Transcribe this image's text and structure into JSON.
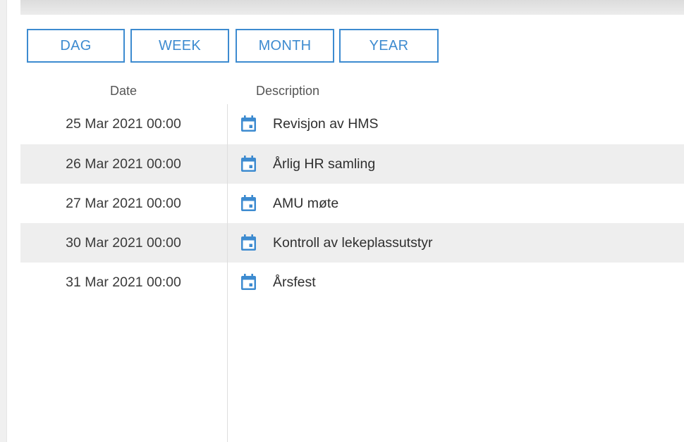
{
  "view_buttons": {
    "day": "DAG",
    "week": "WEEK",
    "month": "MONTH",
    "year": "YEAR"
  },
  "columns": {
    "date": "Date",
    "description": "Description"
  },
  "events": [
    {
      "date": "25 Mar 2021 00:00",
      "description": "Revisjon av HMS",
      "icon": "calendar-icon"
    },
    {
      "date": "26 Mar 2021 00:00",
      "description": "Årlig HR samling",
      "icon": "calendar-icon"
    },
    {
      "date": "27 Mar 2021 00:00",
      "description": "AMU møte",
      "icon": "calendar-icon"
    },
    {
      "date": "30 Mar 2021 00:00",
      "description": "Kontroll av lekeplassutstyr",
      "icon": "calendar-icon"
    },
    {
      "date": "31 Mar 2021 00:00",
      "description": "Årsfest",
      "icon": "calendar-icon"
    }
  ],
  "colors": {
    "accent": "#3d8bd0",
    "row_shade": "#eeeeee"
  }
}
